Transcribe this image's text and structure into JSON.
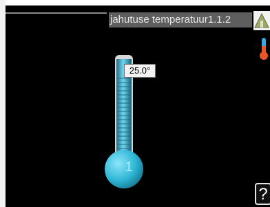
{
  "header": {
    "title": "jahutuse temperatuur1.1.2"
  },
  "setpoint": {
    "value_text": "25.0°",
    "level": 0.9
  },
  "thermometer": {
    "bulb_label": "1"
  },
  "icons": {
    "nav": "home-tree-icon",
    "status": "thermometer-icon",
    "help": "help-icon"
  },
  "help": {
    "label": "?"
  },
  "colors": {
    "accent": "#36c3dc",
    "background": "#000000",
    "title_bar": "#5e5e5e"
  }
}
